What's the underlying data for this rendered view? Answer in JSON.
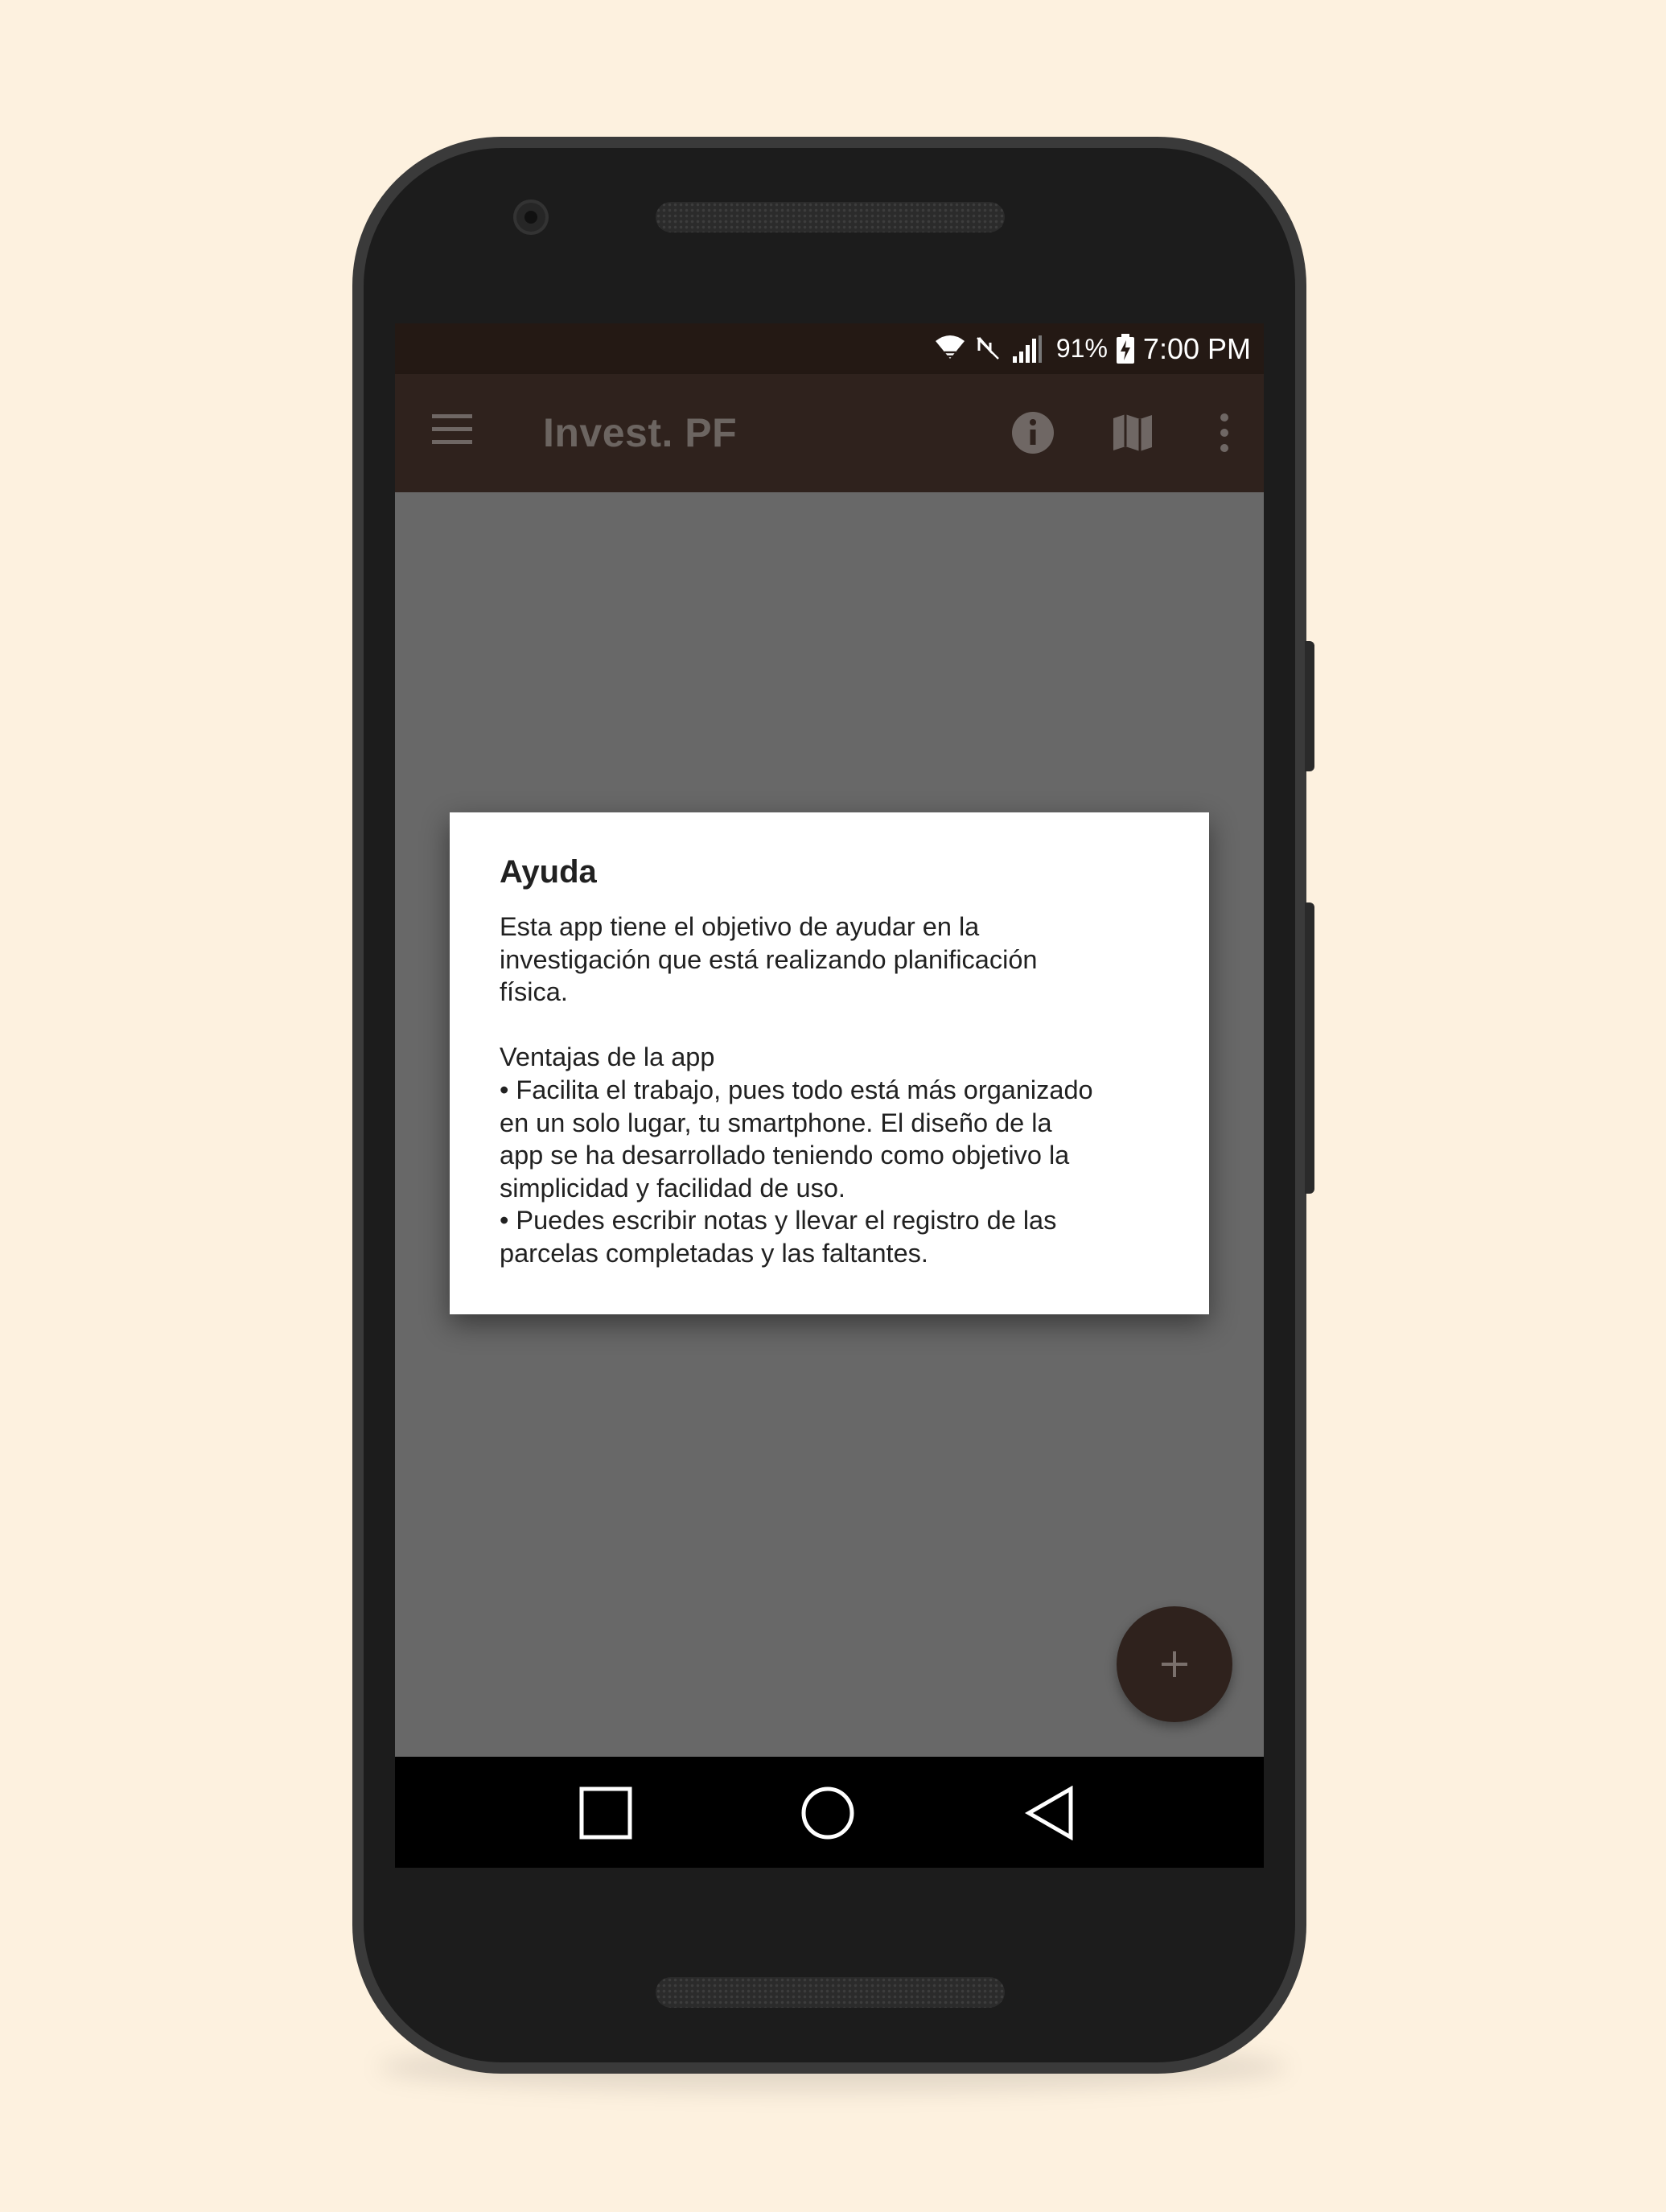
{
  "status_bar": {
    "battery_percent": "91%",
    "time": "7:00 PM",
    "icons": [
      "wifi-icon",
      "no-data-icon",
      "signal-icon",
      "battery-charging-icon"
    ]
  },
  "app_bar": {
    "title": "Invest. PF",
    "icons": [
      "menu-icon",
      "info-icon",
      "map-icon",
      "more-vert-icon"
    ]
  },
  "dialog": {
    "title": "Ayuda",
    "body_lines": [
      "Esta app tiene el objetivo de ayudar en la",
      "investigación que está realizando planificación",
      "física.",
      "",
      "Ventajas de la app",
      "• Facilita el trabajo, pues todo está más organizado",
      "en un solo lugar, tu smartphone. El diseño de la",
      "app se ha desarrollado teniendo como objetivo la",
      "simplicidad y facilidad de uso.",
      "• Puedes escribir notas y llevar el registro de las",
      "parcelas completadas y las faltantes."
    ]
  },
  "fab": {
    "icon": "add-icon"
  },
  "nav_bar": {
    "icons": [
      "recents-icon",
      "home-icon",
      "back-icon"
    ]
  },
  "colors": {
    "background": "#fdf1df",
    "status_bar": "#241914",
    "app_bar": "#2f221d",
    "scrim": "#686868",
    "fab": "#2f221d"
  }
}
